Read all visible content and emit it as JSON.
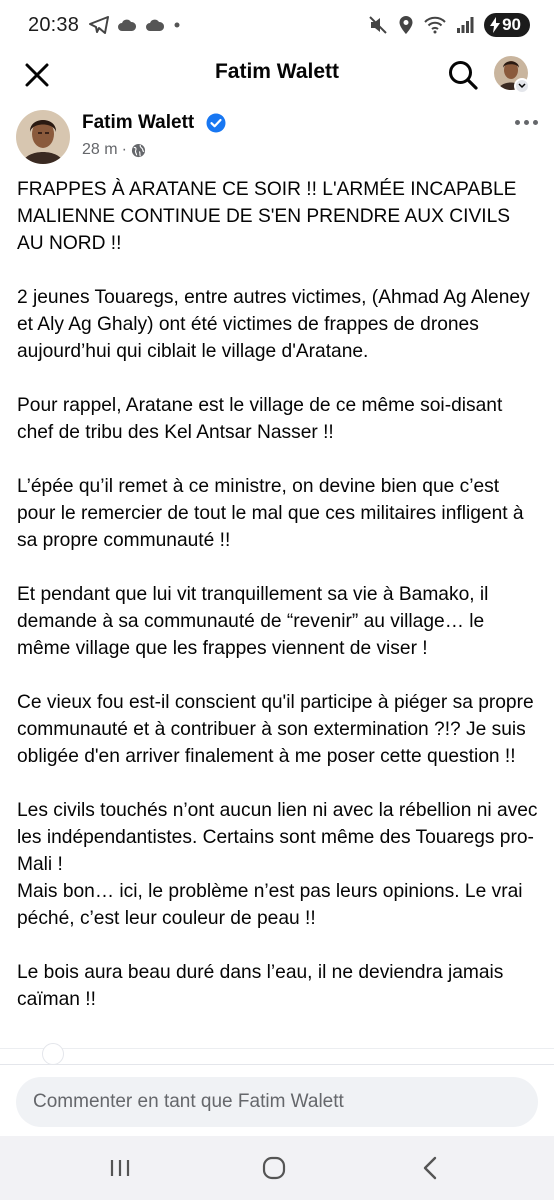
{
  "status_bar": {
    "time": "20:38",
    "battery": "90",
    "left_icons": [
      "telegram-icon",
      "cloud-icon",
      "cloud-icon",
      "dot-icon"
    ],
    "right_icons": [
      "mute-icon",
      "location-icon",
      "wifi-icon",
      "signal-icon",
      "battery-icon"
    ]
  },
  "header": {
    "title": "Fatim Walett"
  },
  "post": {
    "author": "Fatim Walett",
    "time": "28 m",
    "separator": "·",
    "paragraphs": [
      "FRAPPES À ARATANE CE SOIR !! L'ARMÉE INCAPABLE MALIENNE CONTINUE DE S'EN PRENDRE AUX CIVILS AU NORD !!",
      "2 jeunes Touaregs, entre autres victimes, (Ahmad Ag Aleney et Aly Ag Ghaly) ont été victimes de frappes de drones aujourd’hui qui ciblait le village  d'Aratane.",
      "Pour rappel, Aratane est le village de ce même soi-disant chef de tribu des Kel Antsar Nasser !!",
      "L’épée qu’il remet à ce ministre, on devine bien que c’est pour le remercier de tout le mal que ces militaires infligent à sa propre communauté !!",
      "Et pendant que lui vit tranquillement sa vie à Bamako, il demande à sa communauté de “revenir” au village… le même village que les frappes viennent de viser !",
      "Ce vieux fou est-il conscient qu'il participe à piéger sa propre communauté et à contribuer à son extermination ?!? Je suis obligée d'en arriver finalement à me poser cette question !!",
      "Les civils touchés n’ont aucun lien ni avec la rébellion ni avec les indépendantistes. Certains sont même des Touaregs pro-Mali !\nMais bon… ici, le problème n’est pas leurs opinions. Le vrai péché, c’est leur couleur de peau !!",
      "Le bois aura beau duré dans l’eau, il ne deviendra jamais caïman !!"
    ]
  },
  "comment": {
    "placeholder": "Commenter en tant que Fatim Walett"
  },
  "colors": {
    "verified": "#1877f2",
    "secondary_text": "#65676b",
    "input_bg": "#f0f2f5"
  }
}
